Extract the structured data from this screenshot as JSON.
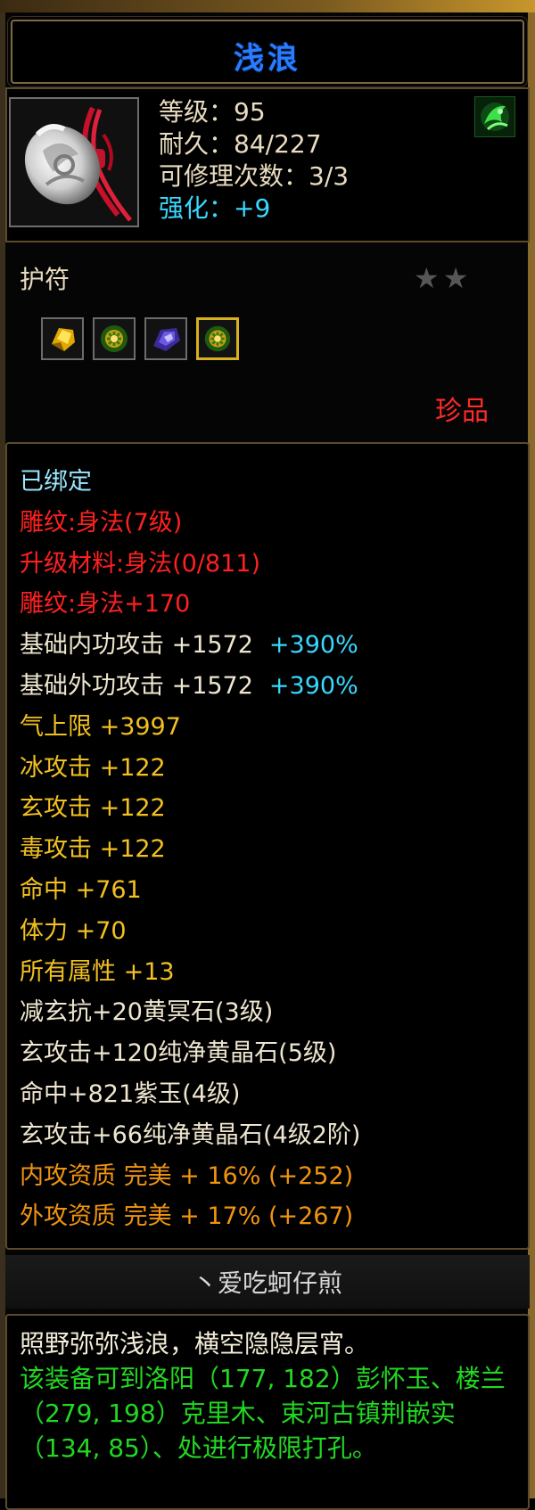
{
  "item": {
    "name": "浅浪",
    "icon": "jade-amulet-icon",
    "skill_icon": "green-skill-icon",
    "stats": [
      {
        "text": "等级：95",
        "color": "#e9dcc0"
      },
      {
        "text": "耐久：84/227",
        "color": "#e9dcc0"
      },
      {
        "text": "可修理次数：3/3",
        "color": "#e9dcc0"
      },
      {
        "text": "强化：+9",
        "color": "#38d8ff"
      }
    ],
    "type": "护符",
    "stars": "★★",
    "sockets": [
      {
        "icon": "yellow-crystal-gem-icon"
      },
      {
        "icon": "green-gold-gem-icon"
      },
      {
        "icon": "purple-jade-gem-icon"
      },
      {
        "icon": "green-gold-gem-icon"
      }
    ],
    "rarity": "珍品"
  },
  "attributes": {
    "bound": "已绑定",
    "engrave": "雕纹:身法(7级)",
    "upgrade": "升级材料:身法(0/811)",
    "engrave_bonus": "雕纹:身法+170",
    "inner_attack": "基础内功攻击 +1572",
    "inner_attack_pct": "+390%",
    "outer_attack": "基础外功攻击 +1572",
    "outer_attack_pct": "+390%",
    "lines": [
      "气上限 +3997",
      "冰攻击 +122",
      "玄攻击 +122",
      "毒攻击 +122",
      "命中 +761",
      "体力 +70",
      "所有属性 +13"
    ],
    "gem_lines": [
      "减玄抗+20黄冥石(3级)",
      "玄攻击+120纯净黄晶石(5级)",
      "命中+821紫玉(4级)",
      "玄攻击+66纯净黄晶石(4级2阶)"
    ],
    "quality_lines": [
      "内攻资质  完美  + 16% (+252)",
      "外攻资质  完美  + 17% (+267)"
    ]
  },
  "owner": "丶爱吃蚵仔煎",
  "description": {
    "flavor": "照野弥弥浅浪，横空隐隐层宵。",
    "hint": "该装备可到洛阳（177, 182）彭怀玉、楼兰（279, 198）克里木、束河古镇荆嵌实（134, 85）、处进行极限打孔。"
  }
}
